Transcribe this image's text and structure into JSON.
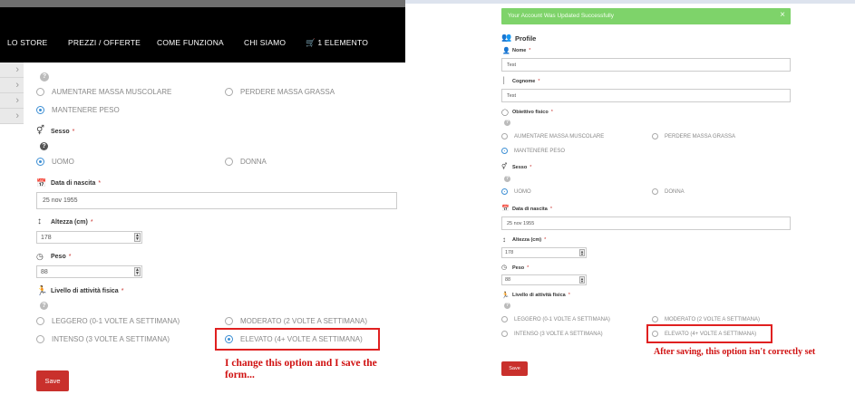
{
  "nav": {
    "items": [
      "LO STORE",
      "PREZZI / OFFERTE",
      "COME FUNZIONA",
      "CHI SIAMO",
      "1 ELEMENTO"
    ],
    "cart_icon": "cart-icon"
  },
  "form": {
    "objective_label": "Obiettivo fisico",
    "objective_options": [
      "AUMENTARE MASSA MUSCOLARE",
      "PERDERE MASSA GRASSA",
      "MANTENERE PESO"
    ],
    "sex_label": "Sesso",
    "sex_options": [
      "UOMO",
      "DONNA"
    ],
    "birth_label": "Data di nascita",
    "birth_value": "25 nov 1955",
    "height_label": "Altezza (cm)",
    "height_value": "178",
    "weight_label": "Peso",
    "weight_value": "88",
    "activity_label": "Livello di attività fisica",
    "activity_options": [
      "LEGGERO (0-1 VOLTE A SETTIMANA)",
      "MODERATO (2 VOLTE A SETTIMANA)",
      "INTENSO (3 VOLTE A SETTIMANA)",
      "ELEVATO (4+ VOLTE A SETTIMANA)"
    ],
    "save_label": "Save",
    "required_mark": "*",
    "help_mark": "?"
  },
  "right": {
    "alert_text": "Your Account Was Updated Successfully",
    "alert_close": "×",
    "profile_title": "Profile",
    "name_label": "Nome",
    "name_value": "Test",
    "surname_label": "Cognome",
    "surname_value": "Test"
  },
  "annotations": {
    "left_note": "I change this option and I save the form...",
    "right_note": "After saving, this option isn't correctly set"
  },
  "colors": {
    "accent": "#3d8fd4",
    "save": "#c9302c",
    "alert": "#7ed36a",
    "annotation": "#e02020",
    "navbar": "#000000"
  }
}
